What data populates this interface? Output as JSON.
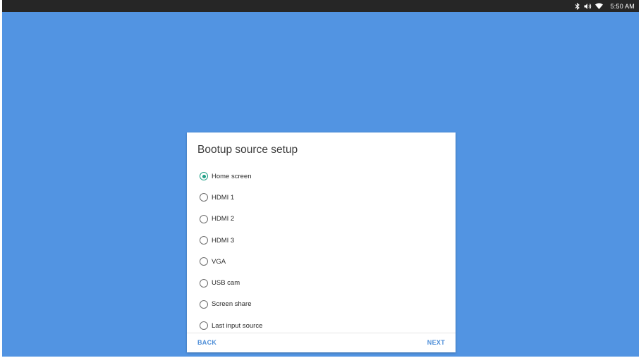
{
  "statusbar": {
    "time": "5:50 AM",
    "icons": [
      "bluetooth-icon",
      "volume-icon",
      "wifi-icon"
    ]
  },
  "dialog": {
    "title": "Bootup source setup",
    "options": [
      {
        "label": "Home screen",
        "selected": true
      },
      {
        "label": "HDMI 1",
        "selected": false
      },
      {
        "label": "HDMI 2",
        "selected": false
      },
      {
        "label": "HDMI 3",
        "selected": false
      },
      {
        "label": "VGA",
        "selected": false
      },
      {
        "label": "USB cam",
        "selected": false
      },
      {
        "label": "Screen share",
        "selected": false
      },
      {
        "label": "Last input source",
        "selected": false
      }
    ],
    "back_label": "BACK",
    "next_label": "NEXT"
  },
  "colors": {
    "background": "#5294e2",
    "statusbar": "#262626",
    "accent": "#1f9f86",
    "button": "#4f8fd8"
  }
}
